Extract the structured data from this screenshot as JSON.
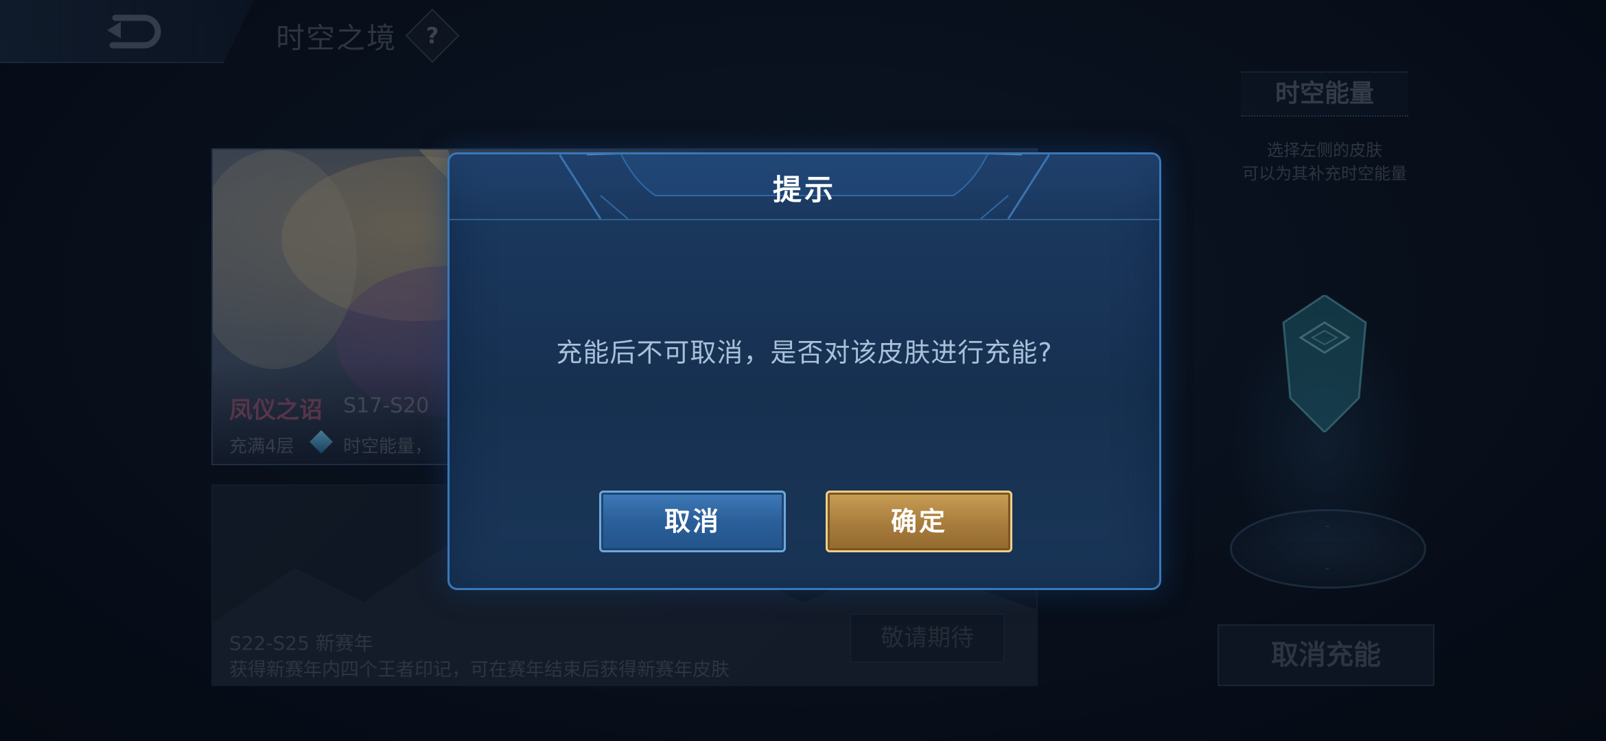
{
  "topbar": {
    "back_icon": "back-arrow-icon",
    "title": "时空之境",
    "help_label": "?"
  },
  "cards": [
    {
      "name": "凤仪之诏",
      "seasons": "S17-S20",
      "desc_prefix": "充满4层",
      "gem_icon": "energy-gem-icon",
      "desc_suffix": "时空能量，"
    },
    {
      "title": "S22-S25 新赛年",
      "desc": "获得新赛年内四个王者印记，可在赛年结束后获得新赛年皮肤",
      "button": "敬请期待"
    }
  ],
  "energy_panel": {
    "title": "时空能量",
    "hint_lines": [
      "选择左侧的皮肤",
      "可以为其补充时空能量"
    ],
    "crystal_icon": "time-energy-crystal-icon",
    "cancel_button": "取消充能"
  },
  "dialog": {
    "title": "提示",
    "message": "充能后不可取消，是否对该皮肤进行充能?",
    "cancel_label": "取消",
    "confirm_label": "确定"
  },
  "colors": {
    "dialog_border": "#3a78b8",
    "cancel_button": "#2a5f9a",
    "confirm_button": "#a87c3c",
    "title_text": "#ffffff"
  }
}
